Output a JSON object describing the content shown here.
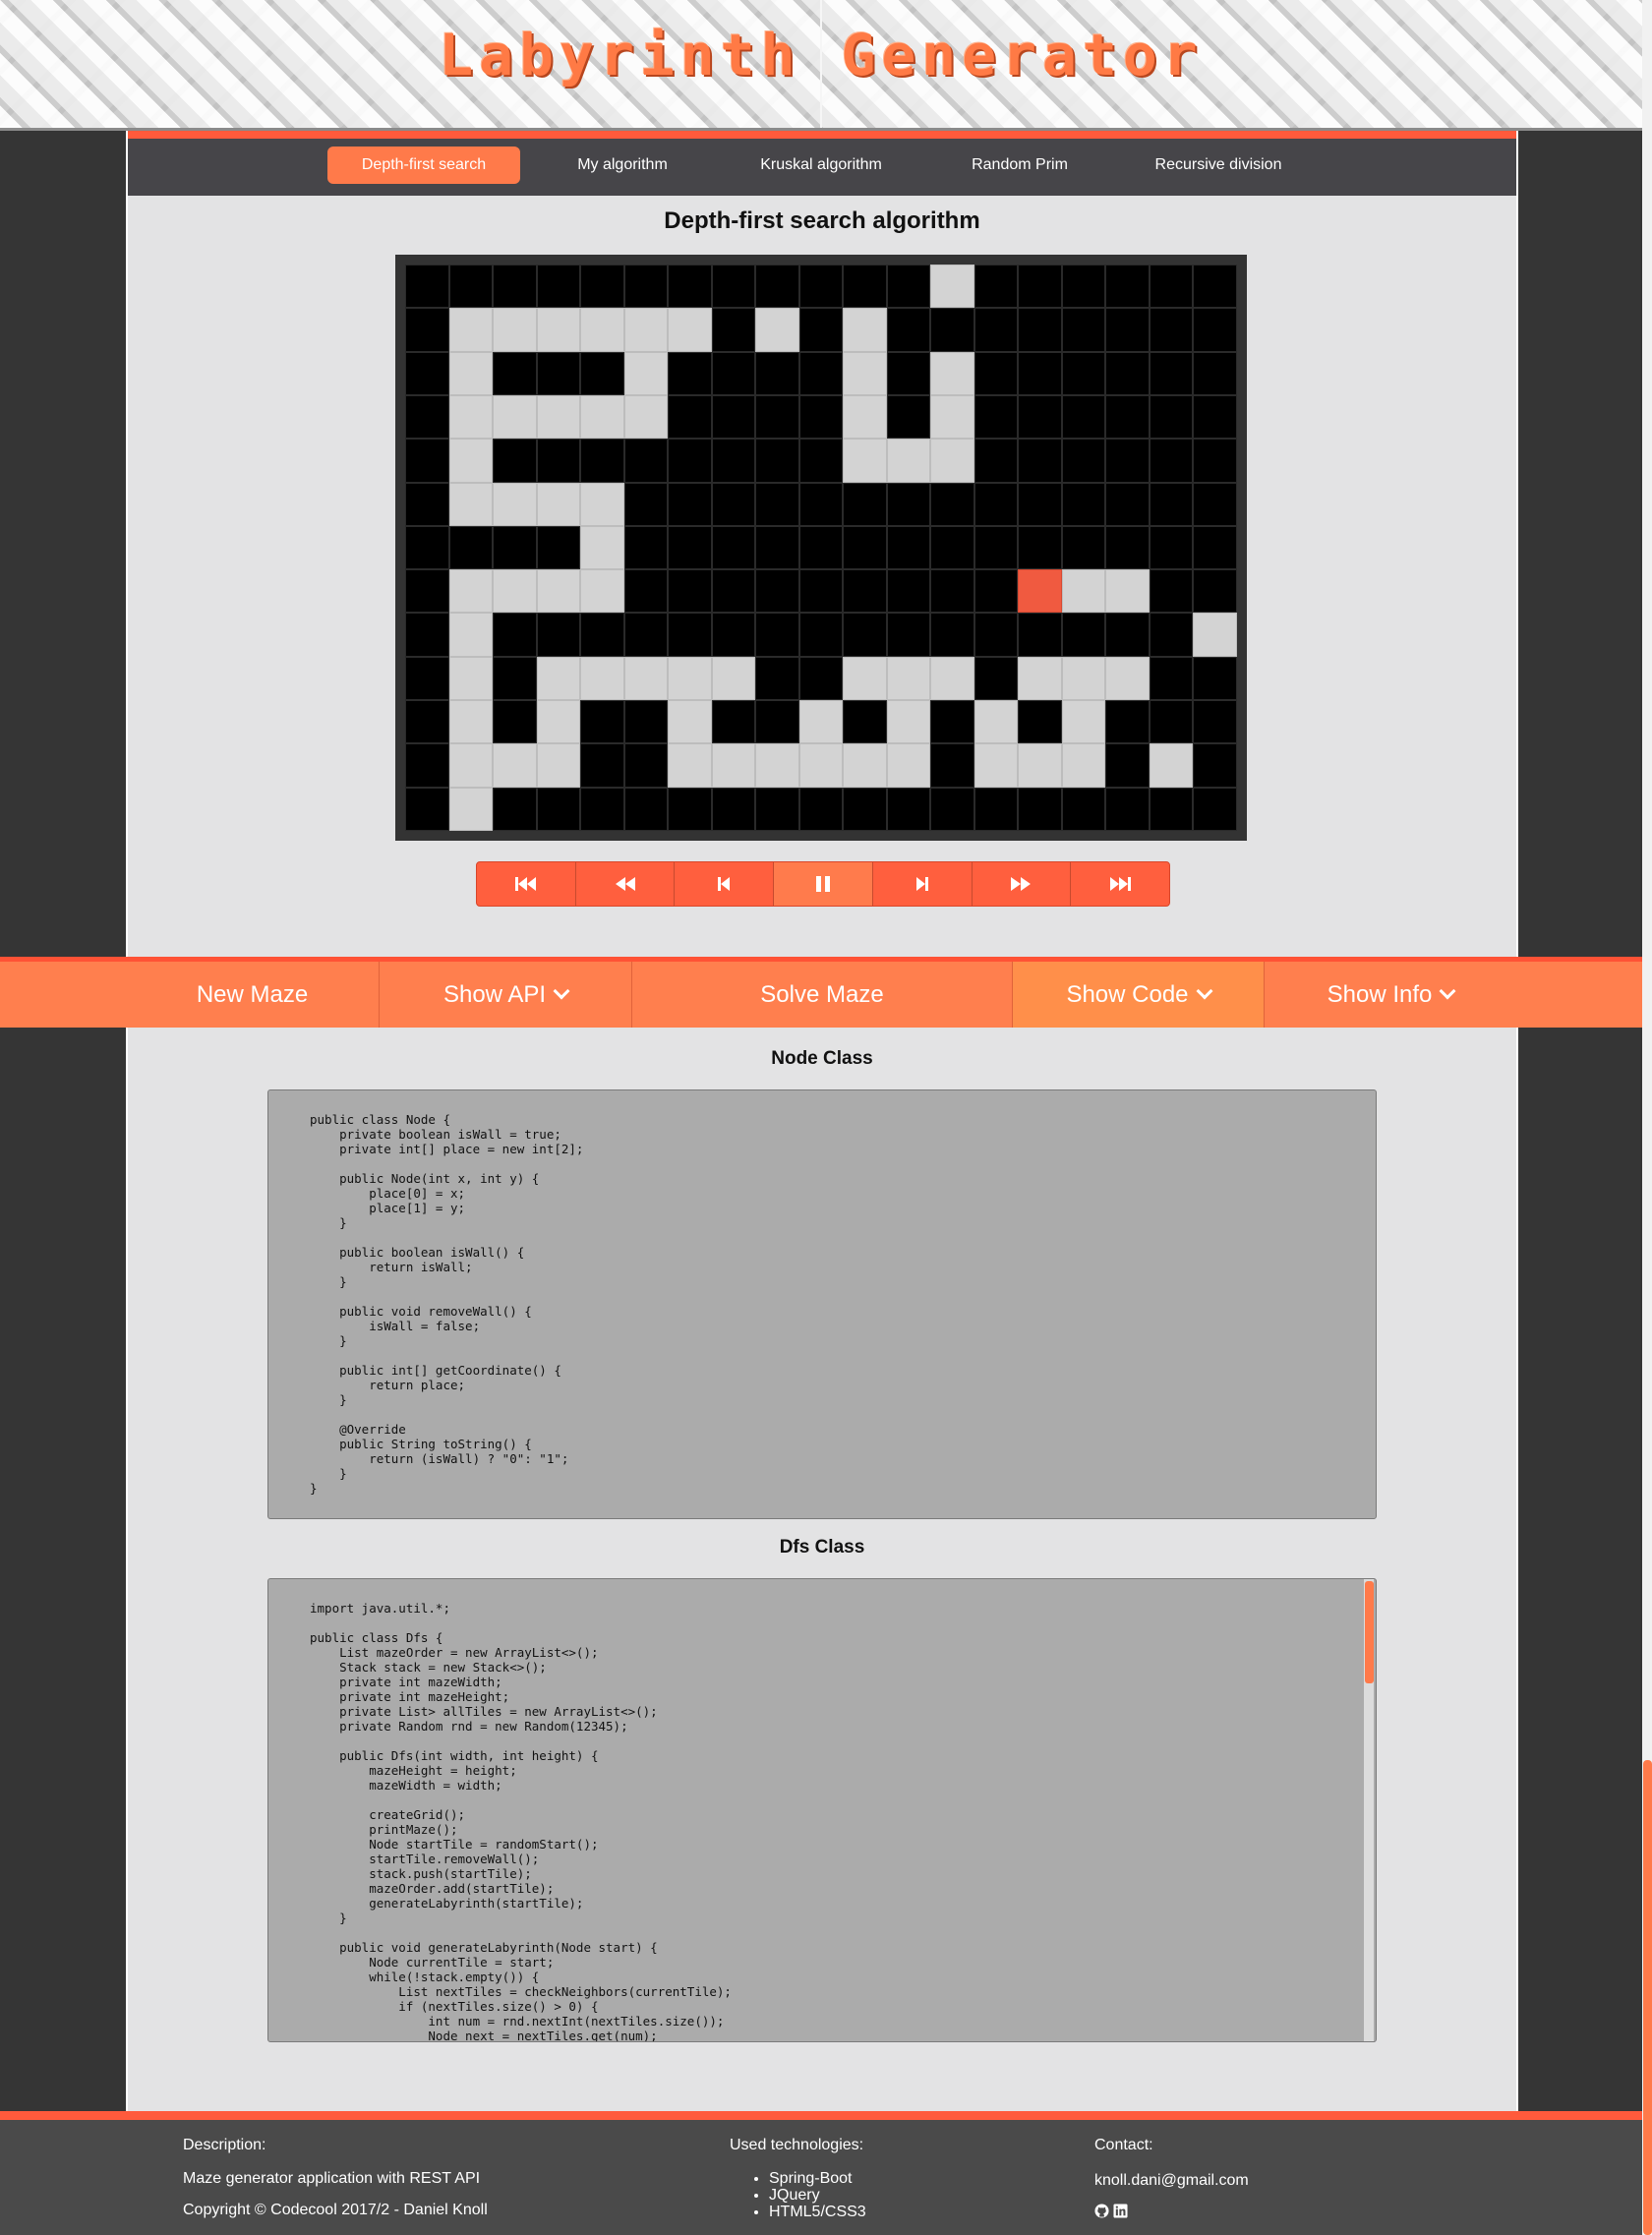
{
  "header": {
    "title": "Labyrinth Generator"
  },
  "nav": {
    "tabs": [
      {
        "label": "Depth-first search",
        "active": true
      },
      {
        "label": "My algorithm"
      },
      {
        "label": "Kruskal algorithm"
      },
      {
        "label": "Random Prim"
      },
      {
        "label": "Recursive division"
      }
    ]
  },
  "main": {
    "algorithm_title": "Depth-first search algorithm",
    "maze": {
      "legend": {
        "#": "wall",
        ".": "path",
        "C": "current"
      },
      "rows": [
        "############.######",
        "#......#.#.########",
        "#.###.####.#.######",
        "#.....####.#.######",
        "#.########...######",
        "#....##############",
        "####.##############",
        "#....#########C..##",
        "#.################.#",
        "#.#.....##...#...#",
        "#.#.##.##.#.#.#.#",
        "#...##......#...#.#",
        "#.#################"
      ]
    },
    "player_controls": [
      {
        "icon": "skip-to-start-icon"
      },
      {
        "icon": "rewind-icon"
      },
      {
        "icon": "step-back-icon"
      },
      {
        "icon": "pause-icon",
        "active": true
      },
      {
        "icon": "step-forward-icon"
      },
      {
        "icon": "fast-forward-icon"
      },
      {
        "icon": "skip-to-end-icon"
      }
    ]
  },
  "action_bar": {
    "new_maze": "New Maze",
    "show_api": "Show API",
    "solve_maze": "Solve Maze",
    "show_code": "Show Code",
    "show_info": "Show Info"
  },
  "code": {
    "node_title": "Node Class",
    "node_code": "public class Node {\n    private boolean isWall = true;\n    private int[] place = new int[2];\n\n    public Node(int x, int y) {\n        place[0] = x;\n        place[1] = y;\n    }\n\n    public boolean isWall() {\n        return isWall;\n    }\n\n    public void removeWall() {\n        isWall = false;\n    }\n\n    public int[] getCoordinate() {\n        return place;\n    }\n\n    @Override\n    public String toString() {\n        return (isWall) ? \"0\": \"1\";\n    }\n}",
    "dfs_title": "Dfs Class",
    "dfs_code": "import java.util.*;\n\npublic class Dfs {\n    List mazeOrder = new ArrayList<>();\n    Stack stack = new Stack<>();\n    private int mazeWidth;\n    private int mazeHeight;\n    private List> allTiles = new ArrayList<>();\n    private Random rnd = new Random(12345);\n\n    public Dfs(int width, int height) {\n        mazeHeight = height;\n        mazeWidth = width;\n\n        createGrid();\n        printMaze();\n        Node startTile = randomStart();\n        startTile.removeWall();\n        stack.push(startTile);\n        mazeOrder.add(startTile);\n        generateLabyrinth(startTile);\n    }\n\n    public void generateLabyrinth(Node start) {\n        Node currentTile = start;\n        while(!stack.empty()) {\n            List nextTiles = checkNeighbors(currentTile);\n            if (nextTiles.size() > 0) {\n                int num = rnd.nextInt(nextTiles.size());\n                Node next = nextTiles.get(num);"
  },
  "footer": {
    "description_heading": "Description:",
    "description_text": "Maze generator application with REST API",
    "copyright": "Copyright © Codecool 2017/2 - Daniel Knoll",
    "tech_heading": "Used technologies:",
    "technologies": [
      "Spring-Boot",
      "JQuery",
      "HTML5/CSS3"
    ],
    "contact_heading": "Contact:",
    "email": "knoll.dani@gmail.com",
    "icons": [
      "github-icon",
      "linkedin-icon"
    ]
  },
  "colors": {
    "accent": "#ff7f4e",
    "accent_dark": "#ff5235",
    "page_bg": "#353535",
    "content_bg": "#e3e3e4"
  }
}
